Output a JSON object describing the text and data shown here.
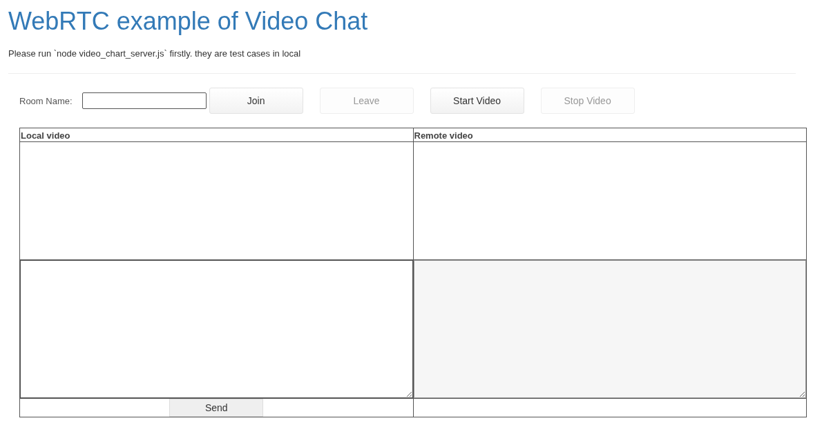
{
  "title": "WebRTC example of Video Chat",
  "subtitle": "Please run `node video_chart_server.js` firstly. they are test cases in local",
  "room_field": {
    "label": "Room Name:"
  },
  "buttons": [
    {
      "label": "Join",
      "disabled": false
    },
    {
      "label": "Leave",
      "disabled": true
    },
    {
      "label": "Start Video",
      "disabled": false
    },
    {
      "label": "Stop Video",
      "disabled": true
    }
  ],
  "table": {
    "columns": [
      "Local video",
      "Remote video"
    ]
  },
  "chat": {
    "input": {
      "disabled": false
    },
    "output": {
      "disabled": true
    }
  },
  "send_button": {
    "label": "Send",
    "disabled": false
  }
}
